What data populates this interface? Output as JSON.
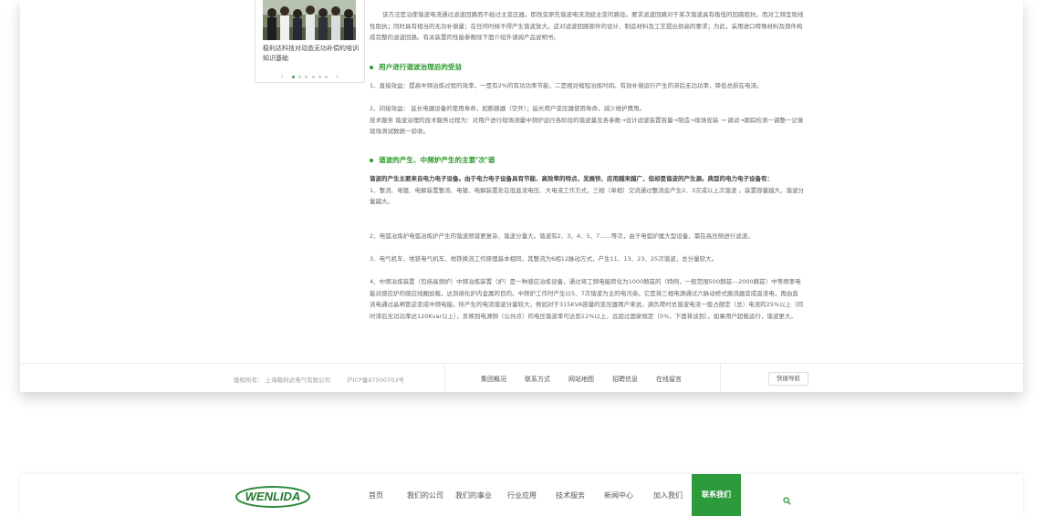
{
  "sidebar": {
    "caption": "稳利达科技对动态无功补偿的培训知识基础",
    "prev_label": "‹",
    "next_label": "›"
  },
  "article": {
    "intro": "该方法是沿使谐波电流通过滤波回路而不经过主变压器，即改变原先谐波电流流经主变的路径。要求滤波回路对于某次谐波具有极低的回路阻抗，而对工频呈现线性阻抗；同时具有相当的无功补偿量；在任何时候不得产生谐波放大。这对滤波回路部件的设计、制造材料及工艺提出很高的要求；为此，采用进口特殊材料及部件构成完整的滤波回路。有关装置的性能参数除下面介绍外请阅产品说明书。",
    "heading1": "用户进行谐波治理后的受益",
    "p1": "1、直接效益：提高中频冶炼过程的效率，一是有2%的有功功率节能，二是相对缩短冶炼时间。有效补偿运行产生的滞后无功功率，降低总损在电流。",
    "p2": "2、间接效益： 延长电器设备的使用寿命，如断路器（空开）；延长用户变压器使用寿命，减少维护费用。",
    "p3": "技术服务 谐波治理的技术服务过程为：对用户进行现场测量中频炉运行各阶段的谐波量及各参数→设计滤波装置容量→制造→现场安装 → 调试→跟踪检测一调整一记录现场测试数据一验收。",
    "heading2": "谐波的产生、中频炉产生的主要‘次’谐",
    "p4": "谐波的产生主要来自电力电子设备。由于电力电子设备具有节能、高效率的特点，发展快、应用越来越广，但却是谐波的产生源。典型的电力电子设备有：",
    "p5": "1、整流、电镀、电解装置整流、电镀、电解装置处在低直流电压、大电流工作方式，三相（单相）交流通过整流会产生2、3次或以上次谐波 。装置容量越大，谐波分量越大。",
    "p6": "2、电弧冶炼炉电弧冶炼炉产生的谐波频谱更复杂、谐波分量大。谐波有2、3、4、5、7......等次，由于电弧炉属大型设备，需在高压侧进行滤波。",
    "p7": "3、电气机车、地铁电气机车、地铁换流工作原理基本相同，其整流为6相12脉动方式，产生11、13、23、25次谐波，总分量较大。",
    "p8": "4、中频冶炼装置（包括高频炉）中频冶炼装置（炉）是一种感应冶炼设备，通过将工频电能转化为1000赫兹的（特例，一般范围500赫兹---2000赫兹）中等频率电能对感应炉的感应线圈加载，达到熔化炉内金属的目的。中频炉工作时产生以5、7次谐波为主的电污染。它是将三相电源通过六脉动桥式换流器变成直流电，再由直流电通过晶闸管逆变成中频电能。所产生的电流谐波分量较大，例如对于315KVA容量的变压器用户来说，满负荷时总谐波电流一般占额定（总）电流的25%以上（同时滞后无功功率达120Kvar以上），反映到电源侧（公共点）的电压谐波率可达到12%以上，远超过国家规定（5%，下面将谈到）。如果用户超载运行，谐波更大。"
  },
  "footer": {
    "copyright": "版权所有： 上海稳利达电气有限公司",
    "icp": "沪ICP备07500703号",
    "links": [
      "集团概况",
      "联系方式",
      "网站地图",
      "招聘信息",
      "在线留言"
    ],
    "quick_nav": "快捷导航"
  },
  "navbar": {
    "logo_text": "WENLIDA",
    "items": [
      "首页",
      "我们的公司",
      "我们的事业",
      "行业应用",
      "技术服务",
      "新闻中心",
      "加入我们",
      "联系我们"
    ],
    "active_index": 7,
    "search_icon": "search-icon"
  },
  "colors": {
    "accent": "#2d9a3c",
    "heading": "#2b9a2b"
  }
}
